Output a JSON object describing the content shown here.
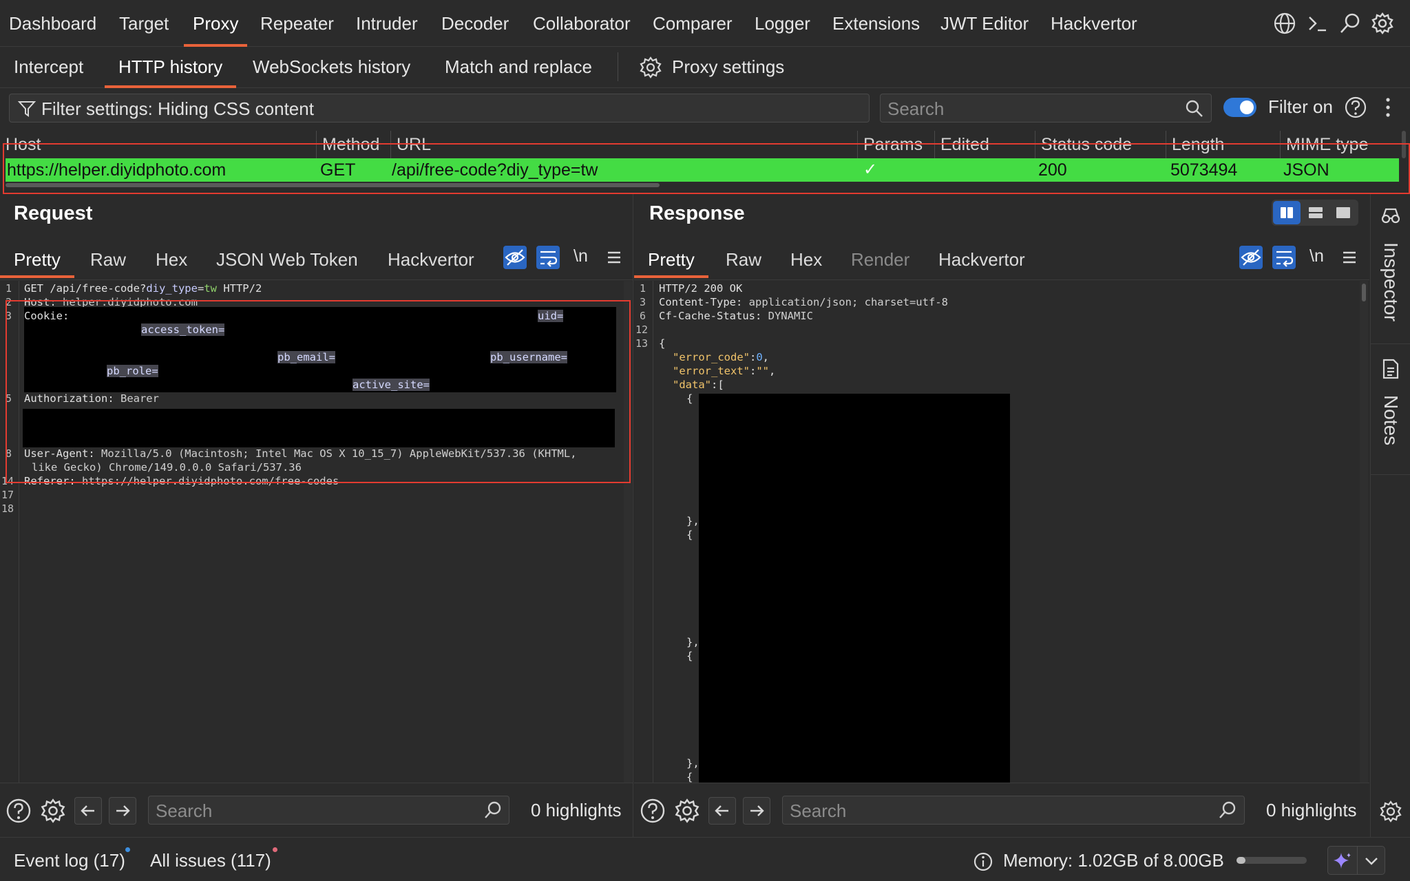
{
  "topnav": {
    "items": [
      "Dashboard",
      "Target",
      "Proxy",
      "Repeater",
      "Intruder",
      "Decoder",
      "Collaborator",
      "Comparer",
      "Logger",
      "Extensions",
      "JWT Editor",
      "Hackvertor"
    ],
    "active": "Proxy",
    "icons": [
      "globe-icon",
      "terminal-icon",
      "search-icon",
      "gear-icon"
    ]
  },
  "subnav": {
    "items": [
      "Intercept",
      "HTTP history",
      "WebSockets history",
      "Match and replace"
    ],
    "active": "HTTP history",
    "settings_label": "Proxy settings"
  },
  "filter": {
    "label": "Filter settings: Hiding CSS content",
    "search_placeholder": "Search",
    "toggle_label": "Filter on",
    "toggle_on": true
  },
  "table": {
    "columns": [
      "Host",
      "Method",
      "URL",
      "Params",
      "Edited",
      "Status code",
      "Length",
      "MIME type"
    ],
    "rows": [
      {
        "host": "https://helper.diyidphoto.com",
        "method": "GET",
        "url": "/api/free-code?diy_type=tw",
        "params": "✓",
        "edited": "",
        "status": "200",
        "length": "5073494",
        "mime": "JSON"
      }
    ],
    "row_color": "#44dc44"
  },
  "request": {
    "title": "Request",
    "tabs": [
      "Pretty",
      "Raw",
      "Hex",
      "JSON Web Token",
      "Hackvertor"
    ],
    "active_tab": "Pretty",
    "newline_label": "\\n",
    "line_numbers": [
      "1",
      "2",
      "3",
      "5",
      "8",
      "14",
      "17",
      "18"
    ],
    "line1_a": "GET /api/free-code?",
    "line1_b": "diy_type",
    "line1_c": "=",
    "line1_d": "tw",
    "line1_e": " HTTP/2",
    "line2_key": "Host: ",
    "line2_val": "helper.diyidphoto.com",
    "line3_key": "Cookie:",
    "cookie_uid": "uid=",
    "cookie_access_token": "access_token=",
    "cookie_pb_email": "pb_email=",
    "cookie_pb_username": "pb_username=",
    "cookie_pb_role": "pb_role=",
    "cookie_active_site": "active_site=",
    "line5_key": "Authorization: ",
    "line5_val": "Bearer",
    "line8_key": "User-Agent: ",
    "line8_val": "Mozilla/5.0 (Macintosh; Intel Mac OS X 10_15_7) AppleWebKit/537.36 (KHTML,",
    "line8_cont": "like Gecko) Chrome/149.0.0.0 Safari/537.36",
    "line14_key": "Referer: ",
    "line14_val": "https://helper.diyidphoto.com/free-codes",
    "search_placeholder": "Search",
    "highlights": "0 highlights"
  },
  "response": {
    "title": "Response",
    "tabs": [
      "Pretty",
      "Raw",
      "Hex",
      "Render",
      "Hackvertor"
    ],
    "active_tab": "Pretty",
    "disabled_tab": "Render",
    "newline_label": "\\n",
    "line_numbers": [
      "1",
      "3",
      "6",
      "12",
      "13"
    ],
    "line1": "HTTP/2 200 OK",
    "line3_key": "Content-Type: ",
    "line3_val": "application/json; charset=utf-8",
    "line6_key": "Cf-Cache-Status: ",
    "line6_val": "DYNAMIC",
    "open_brace": "{",
    "error_code_key": "\"error_code\"",
    "error_code_val": "0",
    "error_text_key": "\"error_text\"",
    "error_text_val": "\"\"",
    "data_key": "\"data\"",
    "data_open": ":[",
    "obj_open": "{",
    "obj_close": "},",
    "search_placeholder": "Search",
    "highlights": "0 highlights"
  },
  "sidebar": {
    "inspector": "Inspector",
    "notes": "Notes"
  },
  "status": {
    "event_log": "Event log (17)",
    "all_issues": "All issues (117)",
    "memory": "Memory: 1.02GB of 8.00GB",
    "memory_fraction": 0.13
  }
}
